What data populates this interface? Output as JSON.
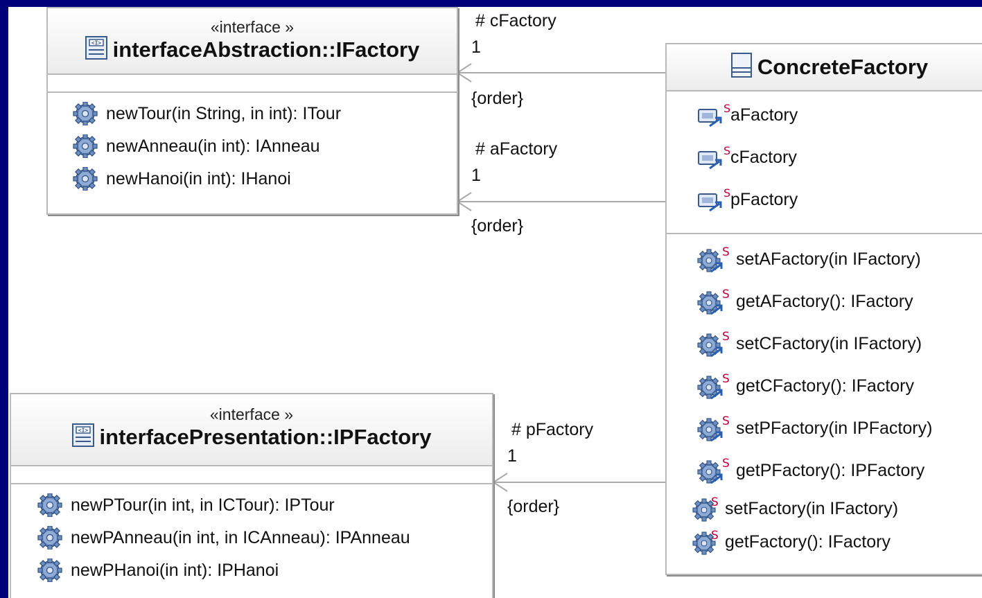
{
  "colors": {
    "background": "#00007a",
    "canvas": "#ffffff",
    "gear": "#4a6fa5",
    "static_mark": "#c0003a"
  },
  "iFactory": {
    "stereotype": "«interface »",
    "name": "interfaceAbstraction::IFactory",
    "operations": [
      {
        "text": "newTour(in String, in int): ITour",
        "icon": "gear-icon"
      },
      {
        "text": "newAnneau(in int): IAnneau",
        "icon": "gear-icon"
      },
      {
        "text": "newHanoi(in int): IHanoi",
        "icon": "gear-icon"
      }
    ]
  },
  "iPFactory": {
    "stereotype": "«interface »",
    "name": "interfacePresentation::IPFactory",
    "operations": [
      {
        "text": "newPTour(in int, in ICTour): IPTour",
        "icon": "gear-icon"
      },
      {
        "text": "newPAnneau(in int, in ICAnneau): IPAnneau",
        "icon": "gear-icon"
      },
      {
        "text": "newPHanoi(in int): IPHanoi",
        "icon": "gear-icon"
      }
    ]
  },
  "concreteFactory": {
    "name": "ConcreteFactory",
    "attributes": [
      {
        "text": "aFactory",
        "icon": "static-field-icon"
      },
      {
        "text": "cFactory",
        "icon": "static-field-icon"
      },
      {
        "text": "pFactory",
        "icon": "static-field-icon"
      }
    ],
    "operations": [
      {
        "text": "setAFactory(in IFactory)",
        "icon": "static-method-icon"
      },
      {
        "text": "getAFactory(): IFactory",
        "icon": "static-method-icon"
      },
      {
        "text": "setCFactory(in IFactory)",
        "icon": "static-method-icon"
      },
      {
        "text": "getCFactory(): IFactory",
        "icon": "static-method-icon"
      },
      {
        "text": "setPFactory(in IPFactory)",
        "icon": "static-method-icon"
      },
      {
        "text": "getPFactory(): IPFactory",
        "icon": "static-method-icon"
      },
      {
        "text": "setFactory(in IFactory)",
        "icon": "static-method-icon"
      },
      {
        "text": "getFactory(): IFactory",
        "icon": "static-method-icon"
      }
    ]
  },
  "associations": [
    {
      "role": "# cFactory",
      "multiplicity": "1",
      "constraint": "{order}"
    },
    {
      "role": "# aFactory",
      "multiplicity": "1",
      "constraint": "{order}"
    },
    {
      "role": "# pFactory",
      "multiplicity": "1",
      "constraint": "{order}"
    }
  ]
}
